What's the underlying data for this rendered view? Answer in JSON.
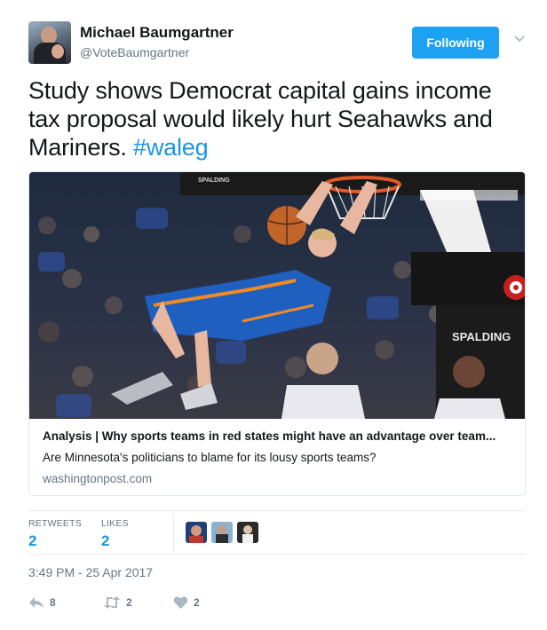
{
  "author": {
    "name": "Michael Baumgartner",
    "handle": "@VoteBaumgartner",
    "follow_label": "Following",
    "avatar_icon": "profile-photo"
  },
  "tweet": {
    "text": "Study shows Democrat capital gains income tax proposal would likely hurt Seahawks and Mariners. ",
    "hashtag": "#waleg"
  },
  "card": {
    "image_icon": "basketball-dunk-photo",
    "title": "Analysis | Why sports teams in red states might have an advantage over team...",
    "description": "Are Minnesota's politicians to blame for its lousy sports teams?",
    "domain": "washingtonpost.com",
    "photo_text": {
      "backboard_brand": "SPALDING",
      "stanchion_brand": "SPALDING"
    }
  },
  "stats": {
    "retweets_label": "RETWEETS",
    "retweets_count": "2",
    "likes_label": "LIKES",
    "likes_count": "2"
  },
  "timestamp": "3:49 PM - 25 Apr 2017",
  "actions": {
    "reply_count": "8",
    "retweet_count": "2",
    "like_count": "2"
  },
  "colors": {
    "accent": "#1da1f2",
    "link": "#1b95e0",
    "muted": "#657786",
    "border": "#e1e8ed"
  }
}
